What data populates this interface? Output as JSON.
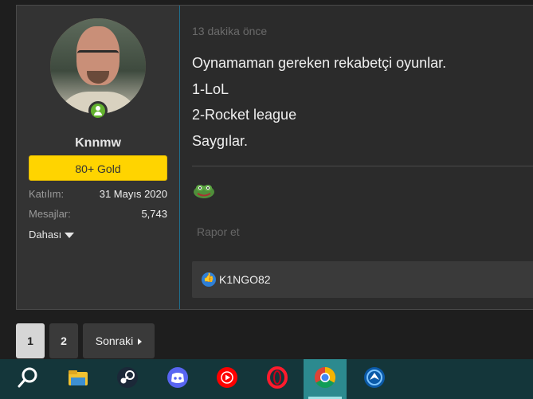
{
  "post": {
    "user": {
      "name": "Knnmw",
      "badge": "80+ Gold",
      "stats": [
        {
          "label": "Katılım:",
          "value": "31 Mayıs 2020"
        },
        {
          "label": "Mesajlar:",
          "value": "5,743"
        }
      ],
      "more_label": "Dahası"
    },
    "timestamp": "13 dakika önce",
    "lines": [
      "Oynamaman gereken rekabetçi oyunlar.",
      "1-LoL",
      "2-Rocket league",
      "Saygılar."
    ],
    "report_label": "Rapor et",
    "reactions": {
      "user": "K1NGO82"
    }
  },
  "pagination": {
    "pages": [
      "1",
      "2"
    ],
    "current": "1",
    "next_label": "Sonraki"
  },
  "taskbar": {
    "items": [
      {
        "icon": "search-icon"
      },
      {
        "icon": "file-explorer-icon"
      },
      {
        "icon": "steam-icon"
      },
      {
        "icon": "discord-icon"
      },
      {
        "icon": "youtube-music-icon"
      },
      {
        "icon": "opera-icon"
      },
      {
        "icon": "chrome-icon",
        "active": true
      },
      {
        "icon": "rocket-league-icon"
      }
    ]
  },
  "colors": {
    "badge": "#ffd400",
    "online": "#63b32e",
    "like": "#2e7fd6",
    "taskbar": "#14363a",
    "taskbar_active": "#2c8a8f"
  }
}
